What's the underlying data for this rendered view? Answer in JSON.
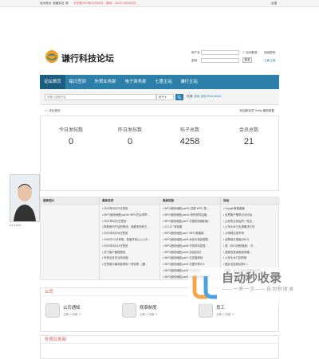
{
  "topbar": {
    "left_links": "设为首页",
    "fav": "收藏本站",
    "lang": "简",
    "notice": "今天是2019年02月09日，期待…20127.000000次",
    "right_link": "百度"
  },
  "header": {
    "site_title": "谦行科技论坛",
    "user_label": "用户名",
    "pass_label": "密码",
    "auto_login": "自动登录",
    "remember": "记住密码",
    "login_btn": "登录",
    "register_link": "立即注册",
    "forgot_link": "找回密码"
  },
  "nav": {
    "items": [
      {
        "label": "论坛首页"
      },
      {
        "label": "每日签到"
      },
      {
        "label": "外贸业务部"
      },
      {
        "label": "电子商务部"
      },
      {
        "label": "七惠主站"
      },
      {
        "label": "谦行主站"
      }
    ]
  },
  "search": {
    "placeholder": "请输入搜索内容",
    "select": "帖子",
    "hot_label": "热搜:",
    "hot_words": "游戏 活动 Rest About"
  },
  "breadcrumb": {
    "text": "⌂ › 论坛首页"
  },
  "new_member": {
    "text": "欢迎新会员: Betty 最新回复"
  },
  "stats": [
    {
      "label": "今日发帖数",
      "value": "0"
    },
    {
      "label": "昨日发帖数",
      "value": "0"
    },
    {
      "label": "帖子总数",
      "value": "4258"
    },
    {
      "label": "会员总数",
      "value": "21"
    }
  ],
  "tabs": {
    "photo_head": "最新图片",
    "photo_caption": "1 2 3 4 5 6",
    "col2_head": "最新发表",
    "col2": [
      "2022年5月22日签到",
      "WPC使用地图 part10 WPC在台湾举…",
      "2021年6月2日签到",
      "带着他问午后的物流，我要来到你王…",
      "2021年5月26日签到",
      "1000平+1分享啦：快速开放认入公平…",
      "2021年5月12日签到",
      "关于客户管理规范",
      "外贸业务员业务流程",
      "在贸易中最多能得到一项优势…(看…"
    ],
    "col3_head": "最新回复",
    "col3": [
      "WPC使用地图 part11 匹配 WPC 里…",
      "WPC使用地图 part11 带的领导运营，…",
      "WPC使用地图 part7 中国的机械制造…",
      "12.12厂商参展",
      "WPC使用地图 part7 WPC参展部…",
      "WPC使用地图 part8 木纹与布纹框框",
      "WPC使用地图 part6 不同材料层叠…",
      "WPC使用地图 part6 活动如何？",
      "WPC使用地图 part7 无发展规划",
      "WPC使用地图 part3 中国外贸3+4",
      "WPC使用地图 part3 活动如何？",
      "WPC使用地图 part3 木纹照旧营业"
    ],
    "col4_head": "热帖",
    "col4": [
      "Google等搜索器",
      "反思客户需求点为何出…",
      "让你的业务由同一性合…",
      "火车头木门出现解决方法",
      "沙特阿拉伯市场",
      "谷歌地方搜索(SEO)",
      "是（SEO阔别搜索）-与…",
      "搜索的常用各类排器…",
      "火车头木门的同相",
      "图片优选网站简介…",
      "隆福：光子五般佳做器械研究",
      "PVC板上找到 简获资"
    ]
  },
  "sections": [
    {
      "title": "公司",
      "forums": [
        {
          "name": "公司通知",
          "stat": "主题: 0 帖数: 0"
        },
        {
          "name": "规章制度",
          "stat": "主题: 0 帖数: 0"
        },
        {
          "name": "员工",
          "stat": "主题: 0 帖数: 0"
        }
      ]
    },
    {
      "title": "外贸业务部",
      "forums": []
    }
  ],
  "watermark": {
    "main": "自动秒收录",
    "sub": "——一来一次——自动秒收录"
  }
}
